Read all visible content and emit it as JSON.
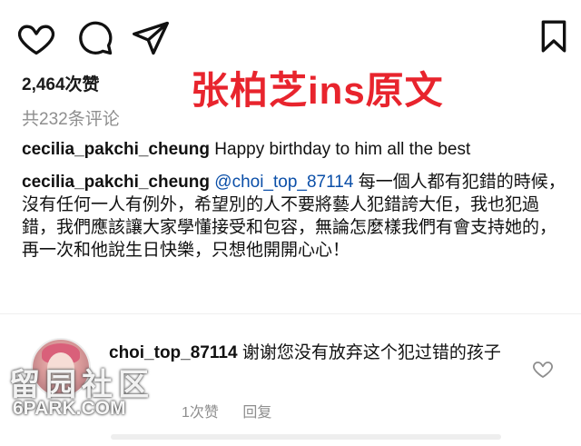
{
  "actions": {
    "like_icon": "heart-icon",
    "comment_icon": "comment-icon",
    "share_icon": "send-icon",
    "save_icon": "bookmark-icon"
  },
  "overlay_title": "张柏芝ins原文",
  "likes": "2,464次赞",
  "comments_count": "共232条评论",
  "caption": {
    "username": "cecilia_pakchi_cheung",
    "text": "Happy birthday to him all the best"
  },
  "comment": {
    "username": "cecilia_pakchi_cheung",
    "mention": "@choi_top_87114",
    "text": "每一個人都有犯錯的時候，沒有任何一人有例外，希望別的人不要將藝人犯錯誇大佢，我也犯過錯，我們應該讓大家學懂接受和包容，無論怎麼樣我們有會支持她的，再一次和他說生日快樂，只想他開開心心！"
  },
  "reply": {
    "username": "choi_top_87114",
    "text": "谢谢您没有放弃这个犯过错的孩子",
    "likes": "1次赞",
    "reply_label": "回复"
  },
  "watermark": {
    "text": "留园社区",
    "url": "6PARK.COM"
  },
  "colors": {
    "overlay_red": "#e8242d",
    "meta_gray": "#8e8e8e",
    "mention_blue": "#0b4fa8"
  }
}
